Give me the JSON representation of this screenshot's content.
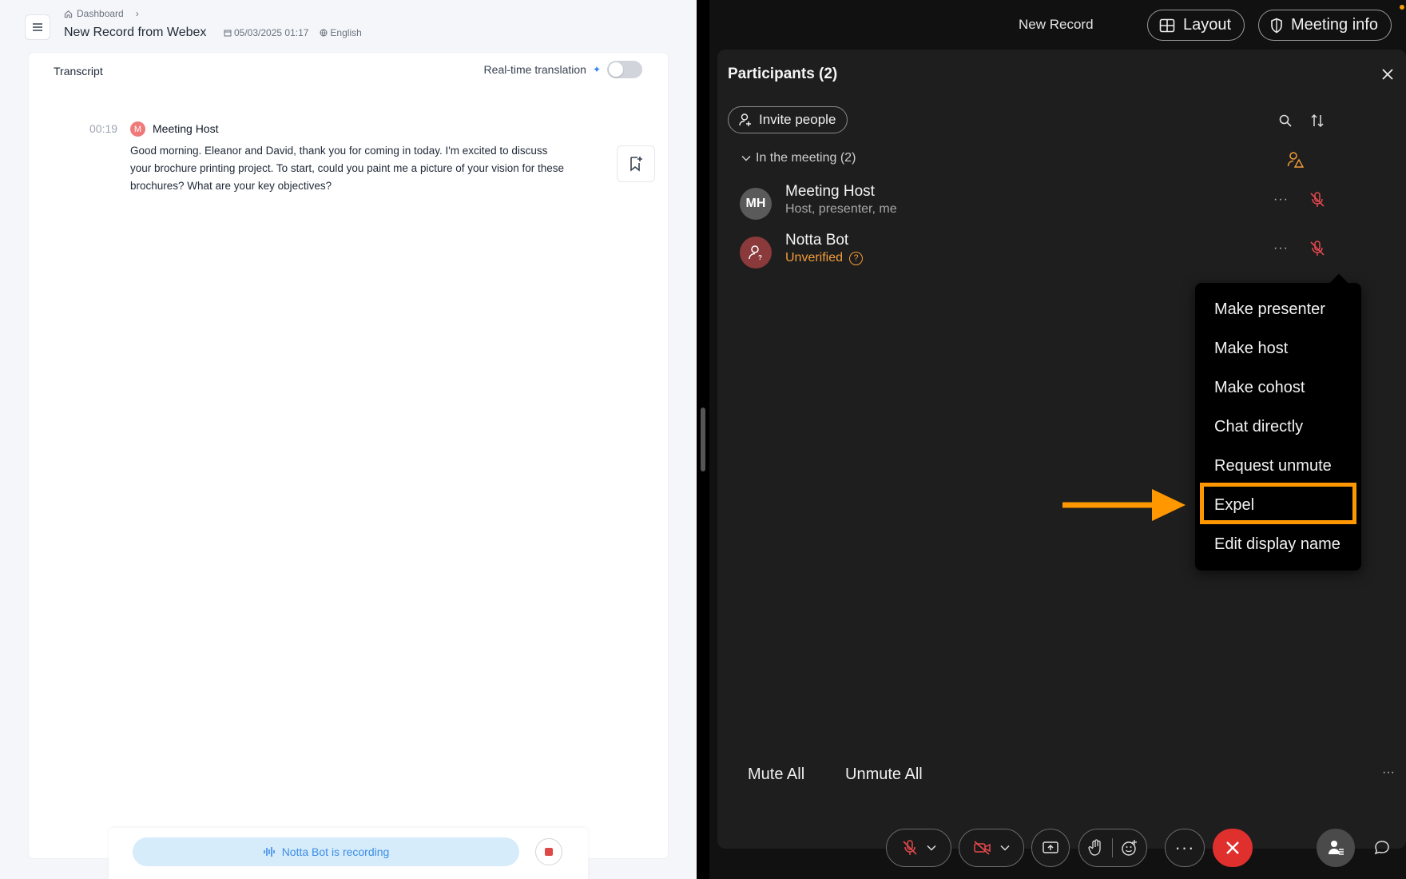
{
  "notta": {
    "breadcrumb": "Dashboard",
    "title": "New Record from Webex",
    "date": "05/03/2025 01:17",
    "language": "English",
    "transcript_label": "Transcript",
    "realtime_translation_label": "Real-time translation",
    "realtime_translation_enabled": false,
    "segment": {
      "time": "00:19",
      "avatar_initial": "M",
      "speaker": "Meeting Host",
      "text": "Good morning. Eleanor and David, thank you for coming in today. I'm excited to discuss your brochure printing project. To start, could you paint me a picture of your vision for these brochures? What are your key objectives?"
    },
    "recording_status": "Notta Bot is recording"
  },
  "webex": {
    "meeting_title": "New Record",
    "layout_label": "Layout",
    "meeting_info_label": "Meeting info",
    "panel_title": "Participants (2)",
    "invite_label": "Invite people",
    "section_label": "In the meeting (2)",
    "participants": [
      {
        "initials": "MH",
        "name": "Meeting Host",
        "subtitle": "Host, presenter, me"
      },
      {
        "initials": "",
        "name": "Notta Bot",
        "subtitle": "Unverified"
      }
    ],
    "context_menu": [
      "Make presenter",
      "Make host",
      "Make cohost",
      "Chat directly",
      "Request unmute",
      "Expel",
      "Edit display name"
    ],
    "highlight_color": "#ff9800",
    "mute_all_label": "Mute All",
    "unmute_all_label": "Unmute All",
    "leave_color": "#e0302e"
  }
}
